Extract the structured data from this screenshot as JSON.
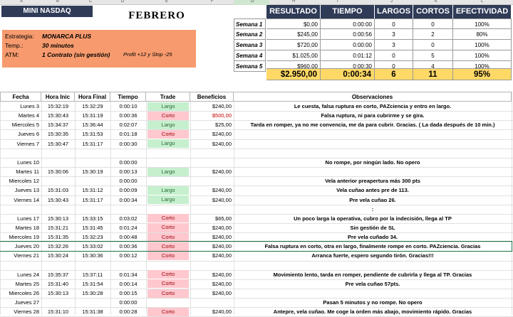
{
  "columns": [
    "A",
    "B",
    "C",
    "D",
    "E",
    "F",
    "G",
    "H",
    "I",
    "J",
    "K",
    "L"
  ],
  "header": {
    "title": "MINI NASDAQ",
    "month": "FEBRERO",
    "strategy_label": "Estrategia:",
    "strategy_value": "MONARCA PLUS",
    "temp_label": "Temp.:",
    "temp_value": "30 minutos",
    "atm_label": "ATM:",
    "atm_value": "1 Contrato (sin gestión)",
    "atm_note": "Profit +12 y Stop -25"
  },
  "summary": {
    "headers": [
      "RESULTADO",
      "TIEMPO",
      "LARGOS",
      "CORTOS",
      "EFECTIVIDAD"
    ],
    "rows": [
      {
        "label": "Semana 1",
        "resultado": "$0,00",
        "tiempo": "0:00:00",
        "largos": "0",
        "cortos": "0",
        "efectividad": "100%"
      },
      {
        "label": "Semana 2",
        "resultado": "$245,00",
        "tiempo": "0:00:56",
        "largos": "3",
        "cortos": "2",
        "efectividad": "80%"
      },
      {
        "label": "Semana 3",
        "resultado": "$720,00",
        "tiempo": "0:00:00",
        "largos": "3",
        "cortos": "0",
        "efectividad": "100%"
      },
      {
        "label": "Semana 4",
        "resultado": "$1.025,00",
        "tiempo": "0:01:12",
        "largos": "0",
        "cortos": "5",
        "efectividad": "100%"
      },
      {
        "label": "Semana 5",
        "resultado": "$960,00",
        "tiempo": "0:00:30",
        "largos": "0",
        "cortos": "4",
        "efectividad": "100%"
      }
    ],
    "totals": {
      "resultado": "$2.950,00",
      "tiempo": "0:00:34",
      "largos": "6",
      "cortos": "11",
      "efectividad": "95%"
    }
  },
  "table": {
    "headers": [
      "Fecha",
      "Hora Inic",
      "Hora Final",
      "Tiempo",
      "Trade",
      "Beneficios",
      "Observaciones"
    ],
    "rows": [
      {
        "fecha": "Lunes 3",
        "ini": "15:32:19",
        "fin": "15:32:29",
        "tiempo": "0:00:10",
        "trade": "Largo",
        "ben": "$240,00",
        "obs": "Le cuesta, falsa ruptura en corto, PAZciencia y entro en largo."
      },
      {
        "fecha": "Martes 4",
        "ini": "15:30:43",
        "fin": "15:31:19",
        "tiempo": "0:00:36",
        "trade": "Corto",
        "ben": "$500,00",
        "obs": "Falsa ruptura, ni para cubrirme y se gira."
      },
      {
        "fecha": "Miercoles 5",
        "ini": "15:34:37",
        "fin": "15:36:44",
        "tiempo": "0:02:07",
        "trade": "Largo",
        "ben": "$25,00",
        "obs": "Tarda en romper, ya no me convencia, me da para cubrir. Gracias. ( La dada después de 10 min.)"
      },
      {
        "fecha": "Jueves 6",
        "ini": "15:30:35",
        "fin": "15:31:53",
        "tiempo": "0:01:18",
        "trade": "Corto",
        "ben": "$240,00",
        "obs": ""
      },
      {
        "fecha": "Viernes 7",
        "ini": "15:30:47",
        "fin": "15:31:17",
        "tiempo": "0:00:30",
        "trade": "Largo",
        "ben": "$240,00",
        "obs": ""
      },
      {
        "fecha": "",
        "ini": "",
        "fin": "",
        "tiempo": "",
        "trade": "",
        "ben": "",
        "obs": ""
      },
      {
        "fecha": "Lunes 10",
        "ini": "",
        "fin": "",
        "tiempo": "0:00:00",
        "trade": "",
        "ben": "",
        "obs": "No rompe, por ningún lado. No opero"
      },
      {
        "fecha": "Martes 11",
        "ini": "15:30:06",
        "fin": "15:30:19",
        "tiempo": "0:00:13",
        "trade": "Largo",
        "ben": "$240,00",
        "obs": ""
      },
      {
        "fecha": "Miercoles 12",
        "ini": "",
        "fin": "",
        "tiempo": "0:00:00",
        "trade": "",
        "ben": "",
        "obs": "Vela anterior preapertura más 300 pts"
      },
      {
        "fecha": "Jueves 13",
        "ini": "15:31:03",
        "fin": "15:31:12",
        "tiempo": "0:00:09",
        "trade": "Largo",
        "ben": "$240,00",
        "obs": "Vela cuñao antes pre de 113."
      },
      {
        "fecha": "Viernes 14",
        "ini": "15:30:43",
        "fin": "15:31:17",
        "tiempo": "0:00:34",
        "trade": "Largo",
        "ben": "$240,00",
        "obs": "Pre vela cuñao 26."
      },
      {
        "fecha": "",
        "ini": "",
        "fin": "",
        "tiempo": "",
        "trade": "",
        "ben": "",
        "obs": ":"
      },
      {
        "fecha": "Lunes 17",
        "ini": "15:30:13",
        "fin": "15:33:15",
        "tiempo": "0:03:02",
        "trade": "Corto",
        "ben": "$65,00",
        "obs": "Un poco larga la operativa, cubro por la indecisión, llega al TP"
      },
      {
        "fecha": "Martes 18",
        "ini": "15:31:21",
        "fin": "15:31:45",
        "tiempo": "0:01:24",
        "trade": "Corto",
        "ben": "$240,00",
        "obs": "Sin gestión de SL"
      },
      {
        "fecha": "Miercoles 19",
        "ini": "15:31:35",
        "fin": "15:32:23",
        "tiempo": "0:00:48",
        "trade": "Corto",
        "ben": "$240,00",
        "obs": "Pre vela cuñado 34."
      },
      {
        "fecha": "Jueves 20",
        "ini": "15:32:26",
        "fin": "15:33:02",
        "tiempo": "0:00:36",
        "trade": "Corto",
        "ben": "$240,00",
        "obs": "Falsa ruptura en corto, otra en largo, finalmente rompe en corto. PAZciencia. Gracias"
      },
      {
        "fecha": "Viernes 21",
        "ini": "15:30:24",
        "fin": "15:30:36",
        "tiempo": "0:00:12",
        "trade": "Corto",
        "ben": "$240,00",
        "obs": "Arranca fuerte, espero segundo tirón. Gracias!!!"
      },
      {
        "fecha": "",
        "ini": "",
        "fin": "",
        "tiempo": "",
        "trade": "",
        "ben": "",
        "obs": ""
      },
      {
        "fecha": "Lunes 24",
        "ini": "15:35:37",
        "fin": "15:37:11",
        "tiempo": "0:01:34",
        "trade": "Corto",
        "ben": "$240,00",
        "obs": "Movimiento lento, tarda en romper, pendiente de cubrirla y llega al TP. Gracias"
      },
      {
        "fecha": "Martes 25",
        "ini": "15:31:40",
        "fin": "15:31:54",
        "tiempo": "0:00:14",
        "trade": "Corto",
        "ben": "$240,00",
        "obs": "Pre vela cuñao 57pts."
      },
      {
        "fecha": "Miercoles 26",
        "ini": "15:30:13",
        "fin": "15:30:28",
        "tiempo": "0:00:15",
        "trade": "Corto",
        "ben": "$240,00",
        "obs": ""
      },
      {
        "fecha": "Jueves 27",
        "ini": "",
        "fin": "",
        "tiempo": "0:00:00",
        "trade": "",
        "ben": "",
        "obs": "Pasan 5 minutos y no rompe. No opero"
      },
      {
        "fecha": "Viernes 28",
        "ini": "15:31:10",
        "fin": "15:31:38",
        "tiempo": "0:00:28",
        "trade": "Corto",
        "ben": "$240,00",
        "obs": "Antepre, vela cuñao. Me coge la orden más abajo, movimiento rápido. Gracias"
      }
    ]
  },
  "colors": {
    "navy": "#2f3b57",
    "orange": "#f79b6e",
    "gold": "#ffd966",
    "largo_bg": "#c6efce",
    "corto_bg": "#ffc7ce",
    "negative": "#c00000"
  }
}
